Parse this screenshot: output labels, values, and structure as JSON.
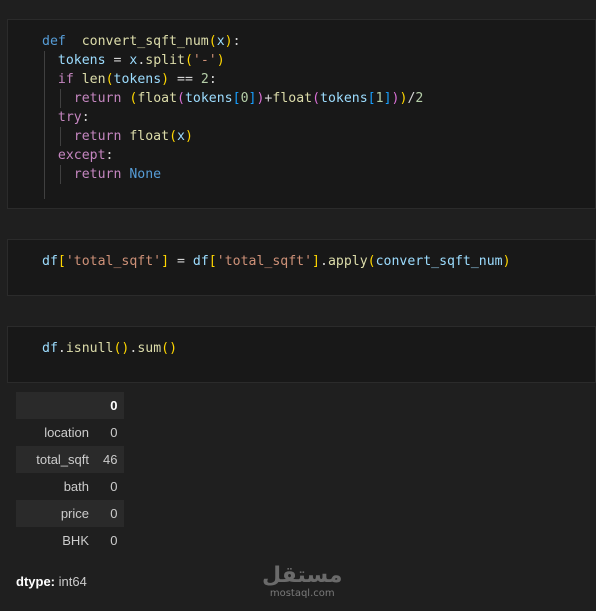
{
  "cells": [
    {
      "lines": [
        [
          [
            "kw",
            "def"
          ],
          [
            "",
            "  "
          ],
          [
            "fn",
            "convert_sqft_num"
          ],
          [
            "p1",
            "("
          ],
          [
            "var",
            "x"
          ],
          [
            "p1",
            ")"
          ],
          [
            "",
            ":"
          ]
        ],
        [
          [
            "",
            "  "
          ],
          [
            "var",
            "tokens"
          ],
          [
            "",
            " = "
          ],
          [
            "var",
            "x"
          ],
          [
            "",
            "."
          ],
          [
            "fn",
            "split"
          ],
          [
            "p1",
            "("
          ],
          [
            "str",
            "'-'"
          ],
          [
            "p1",
            ")"
          ]
        ],
        [
          [
            "",
            "  "
          ],
          [
            "kw2",
            "if"
          ],
          [
            "",
            " "
          ],
          [
            "fn",
            "len"
          ],
          [
            "p1",
            "("
          ],
          [
            "var",
            "tokens"
          ],
          [
            "p1",
            ")"
          ],
          [
            "",
            " == "
          ],
          [
            "num",
            "2"
          ],
          [
            "",
            ":"
          ]
        ],
        [
          [
            "",
            "    "
          ],
          [
            "kw2",
            "return"
          ],
          [
            "",
            " "
          ],
          [
            "p1",
            "("
          ],
          [
            "fn",
            "float"
          ],
          [
            "p2",
            "("
          ],
          [
            "var",
            "tokens"
          ],
          [
            "p3",
            "["
          ],
          [
            "num",
            "0"
          ],
          [
            "p3",
            "]"
          ],
          [
            "p2",
            ")"
          ],
          [
            "",
            "+"
          ],
          [
            "fn",
            "float"
          ],
          [
            "p2",
            "("
          ],
          [
            "var",
            "tokens"
          ],
          [
            "p3",
            "["
          ],
          [
            "num",
            "1"
          ],
          [
            "p3",
            "]"
          ],
          [
            "p2",
            ")"
          ],
          [
            "p1",
            ")"
          ],
          [
            "",
            "/"
          ],
          [
            "num",
            "2"
          ]
        ],
        [
          [
            "",
            "  "
          ],
          [
            "kw2",
            "try"
          ],
          [
            "",
            ":"
          ]
        ],
        [
          [
            "",
            "    "
          ],
          [
            "kw2",
            "return"
          ],
          [
            "",
            " "
          ],
          [
            "fn",
            "float"
          ],
          [
            "p1",
            "("
          ],
          [
            "var",
            "x"
          ],
          [
            "p1",
            ")"
          ]
        ],
        [
          [
            "",
            "  "
          ],
          [
            "kw2",
            "except"
          ],
          [
            "",
            ":"
          ]
        ],
        [
          [
            "",
            "    "
          ],
          [
            "kw2",
            "return"
          ],
          [
            "",
            " "
          ],
          [
            "kw",
            "None"
          ]
        ]
      ]
    },
    {
      "lines": [
        [
          [
            "var",
            "df"
          ],
          [
            "p1",
            "["
          ],
          [
            "str",
            "'total_sqft'"
          ],
          [
            "p1",
            "]"
          ],
          [
            "",
            " = "
          ],
          [
            "var",
            "df"
          ],
          [
            "p1",
            "["
          ],
          [
            "str",
            "'total_sqft'"
          ],
          [
            "p1",
            "]"
          ],
          [
            "",
            "."
          ],
          [
            "fn",
            "apply"
          ],
          [
            "p1",
            "("
          ],
          [
            "var",
            "convert_sqft_num"
          ],
          [
            "p1",
            ")"
          ]
        ]
      ]
    },
    {
      "lines": [
        [
          [
            "var",
            "df"
          ],
          [
            "",
            "."
          ],
          [
            "fn",
            "isnull"
          ],
          [
            "p1",
            "()"
          ],
          [
            "",
            "."
          ],
          [
            "fn",
            "sum"
          ],
          [
            "p1",
            "()"
          ]
        ]
      ]
    }
  ],
  "output": {
    "column_header": "0",
    "rows": [
      {
        "index": "location",
        "value": "0"
      },
      {
        "index": "total_sqft",
        "value": "46"
      },
      {
        "index": "bath",
        "value": "0"
      },
      {
        "index": "price",
        "value": "0"
      },
      {
        "index": "BHK",
        "value": "0"
      }
    ],
    "dtype_label": "dtype:",
    "dtype_value": "int64"
  },
  "watermark": {
    "arabic": "مستقل",
    "latin": "mostaql.com"
  }
}
